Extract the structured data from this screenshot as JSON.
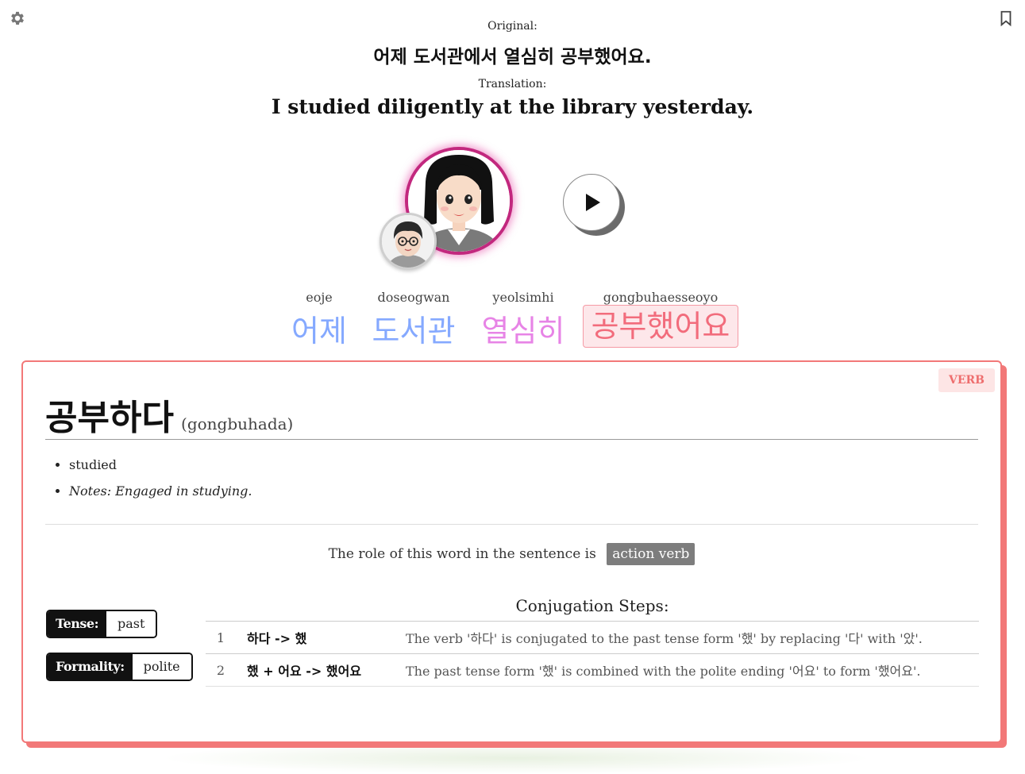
{
  "header": {
    "original_label": "Original:",
    "original_text": "어제 도서관에서 열심히 공부했어요.",
    "translation_label": "Translation:",
    "translation_text": "I studied diligently at the library yesterday."
  },
  "icons": {
    "settings": "gear-icon",
    "bookmark": "bookmark-icon",
    "play": "play-icon"
  },
  "words": [
    {
      "romanization": "eoje",
      "korean": "어제",
      "color": "#85a9ff"
    },
    {
      "romanization": "doseogwan",
      "korean": "도서관",
      "color": "#85a9ff"
    },
    {
      "romanization": "yeolsimhi",
      "korean": "열심히",
      "color": "#e784e6"
    },
    {
      "romanization": "gongbuhaesseoyo",
      "korean": "공부했어요",
      "color": "#f26c7c",
      "selected": true
    }
  ],
  "detail": {
    "pos_badge": "VERB",
    "headword": "공부하다",
    "headword_romanization": "(gongbuhada)",
    "definition": "studied",
    "notes": "Notes: Engaged in studying.",
    "role_text": "The role of this word in the sentence is",
    "role_value": "action verb",
    "tense_label": "Tense:",
    "tense_value": "past",
    "formality_label": "Formality:",
    "formality_value": "polite",
    "conjugation_title": "Conjugation Steps:",
    "steps": [
      {
        "num": "1",
        "form": "하다 -> 했",
        "explanation": "The verb '하다' is conjugated to the past tense form '했' by replacing '다' with '았'."
      },
      {
        "num": "2",
        "form": "했 + 어요 -> 했어요",
        "explanation": "The past tense form '했' is combined with the polite ending '어요' to form '했어요'."
      }
    ]
  },
  "colors": {
    "accent": "#f27878",
    "avatar_ring": "#c2287e"
  }
}
